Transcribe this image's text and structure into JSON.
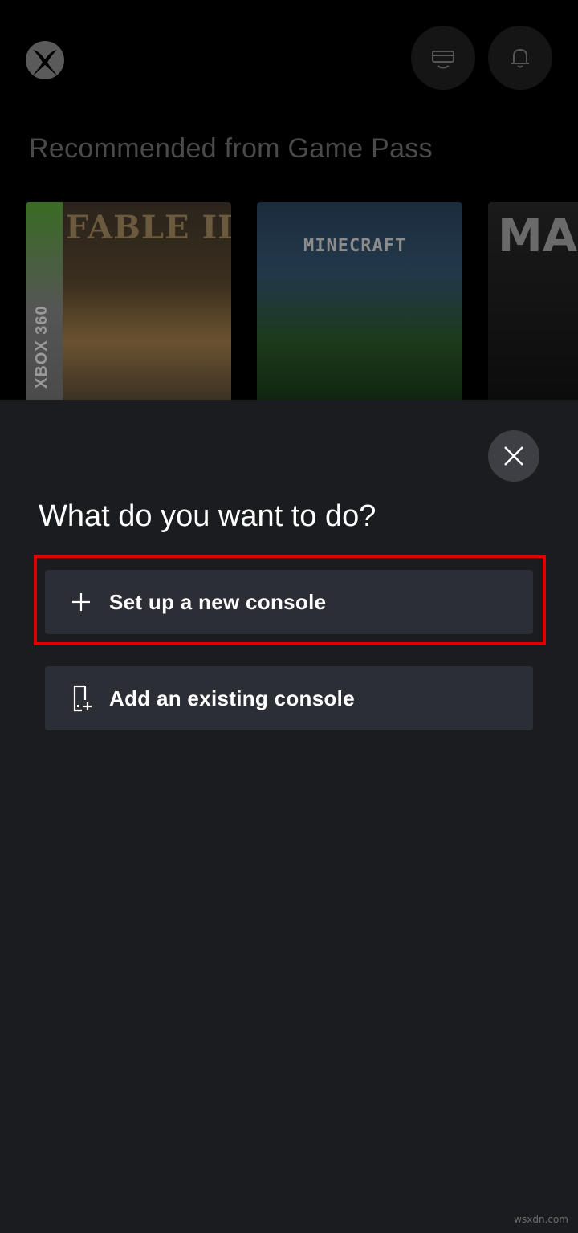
{
  "header": {
    "logo": "xbox-logo-icon",
    "remote_play_icon": "console-remote-icon",
    "notifications_icon": "bell-icon"
  },
  "recommended": {
    "title": "Recommended from Game Pass",
    "tiles": [
      {
        "art_text": "FABLE III",
        "badge": "XBOX 360"
      },
      {
        "art_text": "MINECRAFT"
      },
      {
        "art_text": "MAX"
      }
    ]
  },
  "sheet": {
    "close_icon": "close-icon",
    "title": "What do you want to do?",
    "actions": [
      {
        "label": "Set up a new console",
        "icon": "plus-icon",
        "highlighted": true
      },
      {
        "label": "Add an existing console",
        "icon": "add-console-icon",
        "highlighted": false
      }
    ],
    "highlight_color": "#e00000"
  },
  "watermark": "wsxdn.com"
}
